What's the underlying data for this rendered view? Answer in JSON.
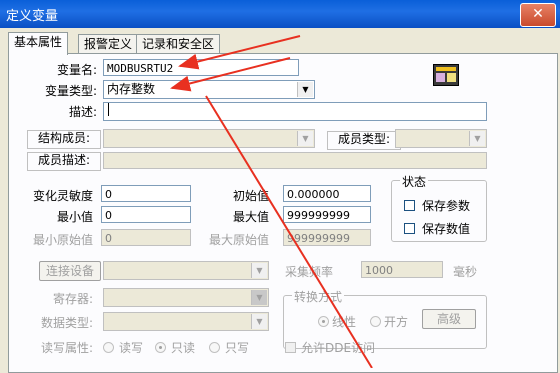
{
  "window": {
    "title": "定义变量",
    "close": "✕"
  },
  "tabs": [
    "基本属性",
    "报警定义",
    "记录和安全区"
  ],
  "form": {
    "var_name_label": "变量名:",
    "var_name_value": "MODBUSRTU2",
    "var_type_label": "变量类型:",
    "var_type_value": "内存整数",
    "desc_label": "描述:",
    "desc_value": "",
    "struct_member_label": "结构成员:",
    "member_type_label": "成员类型:",
    "member_desc_label": "成员描述:",
    "sensitivity_label": "变化灵敏度",
    "sensitivity_value": "0",
    "initial_label": "初始值",
    "initial_value": "0.000000",
    "min_label": "最小值",
    "min_value": "0",
    "max_label": "最大值",
    "max_value": "999999999",
    "min_raw_label": "最小原始值",
    "min_raw_value": "0",
    "max_raw_label": "最大原始值",
    "max_raw_value": "999999999",
    "status_group": "状态",
    "save_params_label": "保存参数",
    "save_values_label": "保存数值",
    "connect_device_label": "连接设备",
    "collect_freq_label": "采集频率",
    "collect_freq_value": "1000",
    "ms_label": "毫秒",
    "register_label": "寄存器:",
    "data_type_label": "数据类型:",
    "convert_group": "转换方式",
    "linear_label": "线性",
    "sqrt_label": "开方",
    "advanced_label": "高级",
    "rw_label": "读写属性:",
    "read_write_label": "读写",
    "read_only_label": "只读",
    "write_only_label": "只写",
    "allow_dde_label": "允许DDE访问"
  },
  "colors": {
    "annotation": "#e83020",
    "titlebar": "#0a5fd8"
  }
}
